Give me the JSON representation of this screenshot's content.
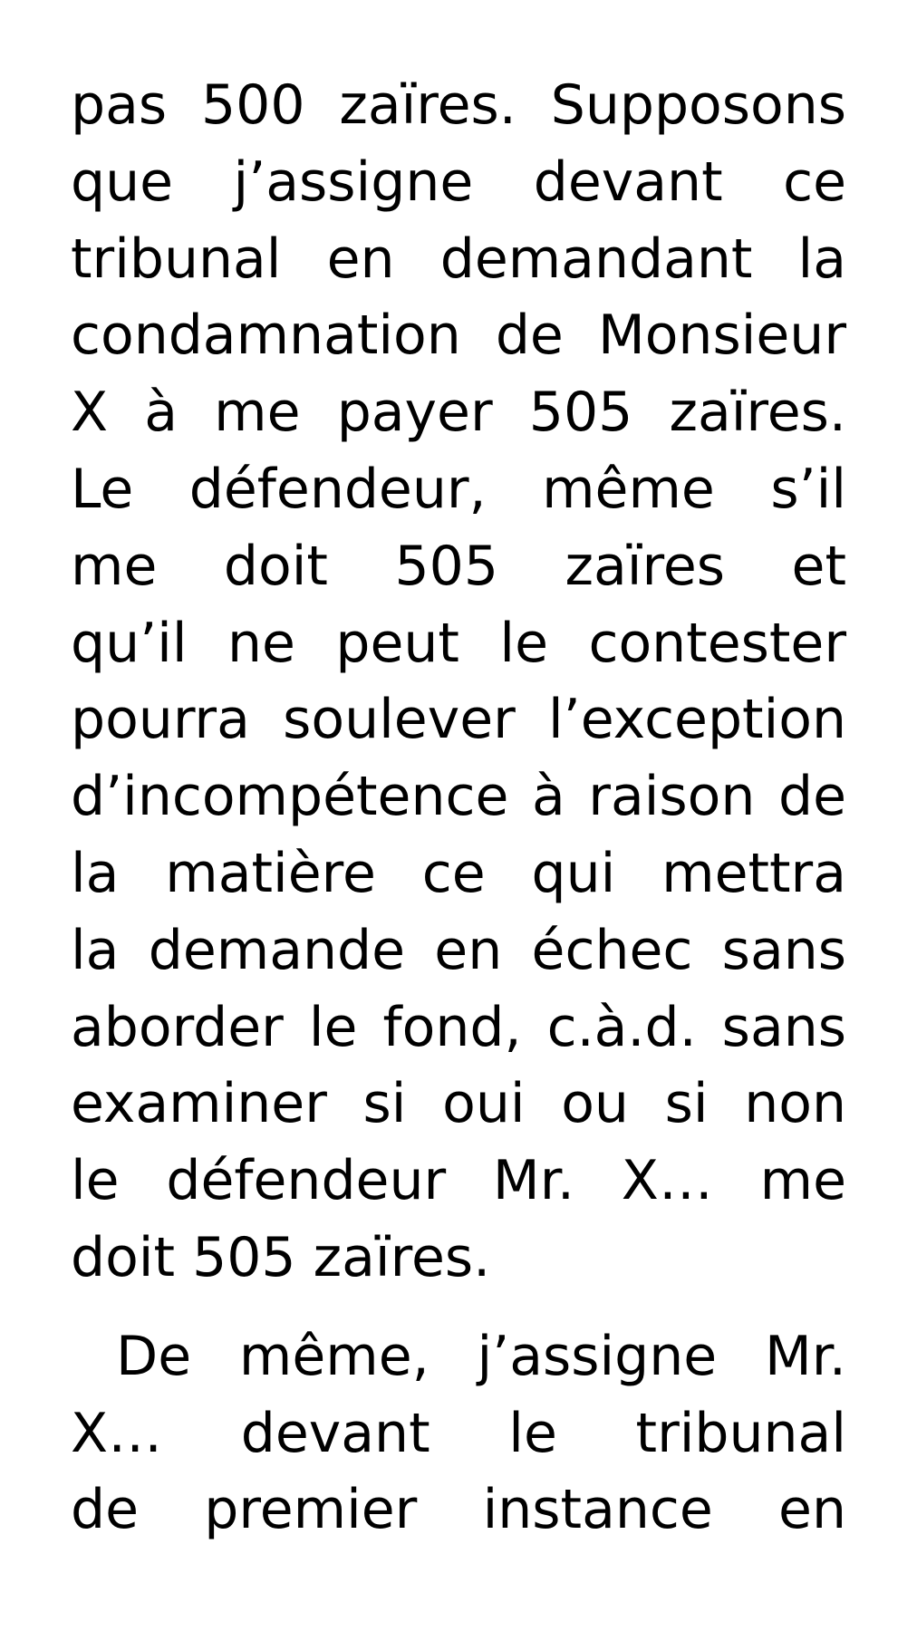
{
  "document": {
    "paragraphs": [
      {
        "lines": [
          "pas 500 zaïres. Supposons",
          "que j’assigne devant ce",
          "tribunal en demandant la",
          "condamnation de Monsieur",
          "X à me payer 505 zaïres.",
          "Le défendeur, même s’il",
          "me doit 505 zaïres et",
          "qu’il ne peut le contester",
          "pourra soulever l’exception",
          "d’incompétence à raison de",
          "la matière ce qui mettra",
          "la demande en échec sans",
          "aborder le fond, c.à.d. sans",
          "examiner si oui ou si non",
          "le défendeur Mr. X… me",
          "doit 505 zaïres."
        ]
      },
      {
        "lines": [
          "De même, j’assigne Mr.",
          "X… devant le tribunal",
          "de premier instance en"
        ]
      }
    ]
  }
}
